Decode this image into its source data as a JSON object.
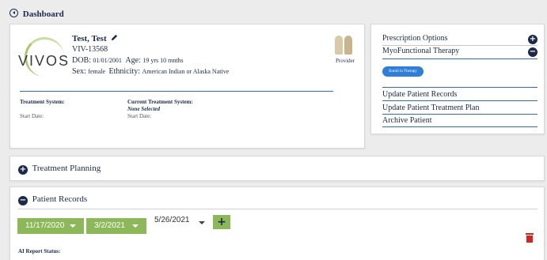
{
  "header": {
    "title": "Dashboard"
  },
  "patient": {
    "name": "Test, Test",
    "id": "VIV-13568",
    "dob_label": "DOB:",
    "dob": "01/01/2001",
    "age_label": "Age:",
    "age": "19 yrs 10 mnths",
    "sex_label": "Sex:",
    "sex": "female",
    "ethnicity_label": "Ethnicity:",
    "ethnicity": "American Indian or Alaska Native",
    "logo_text": "VIVOS",
    "provider_label": "Provider"
  },
  "treatment": {
    "system_label": "Treatment System:",
    "start_label": "Start Date:",
    "current_label": "Current Treatment System:",
    "current_value": "None Selected",
    "current_start_label": "Start Date:"
  },
  "side": {
    "prescription": "Prescription Options",
    "myofunctional": "MyoFunctional Therapy",
    "enroll": "Enroll in Therapy",
    "update_records": "Update Patient Records",
    "update_plan": "Update Patient Treatment Plan",
    "archive": "Archive Patient"
  },
  "treatment_planning": {
    "title": "Treatment Planning"
  },
  "records": {
    "title": "Patient Records",
    "dates": [
      "11/17/2020",
      "3/2/2021",
      "5/26/2021"
    ],
    "add": "+",
    "ai_status": "AI Report Status:"
  },
  "colors": {
    "navy": "#1b2a4a",
    "green": "#8db85a",
    "blue": "#2f6fb0",
    "red": "#d9231f"
  }
}
